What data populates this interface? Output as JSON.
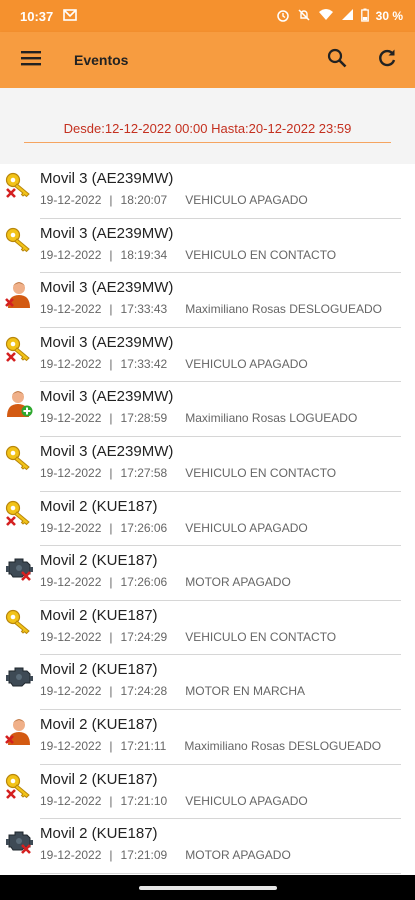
{
  "status_bar": {
    "time": "10:37",
    "battery": "30 %",
    "left_icons": [
      "mail-icon"
    ],
    "right_icons": [
      "alarm-icon",
      "mute-icon",
      "wifi-icon",
      "signal-icon",
      "battery-icon"
    ]
  },
  "app_bar": {
    "title": "Eventos",
    "icons": [
      "menu-icon",
      "search-icon",
      "refresh-icon"
    ],
    "color": "#f79c40"
  },
  "date_range": "Desde:12-12-2022 00:00  Hasta:20-12-2022 23:59",
  "events": [
    {
      "vehicle": "Movil 3 (AE239MW)",
      "date": "19-12-2022",
      "time": "18:20:07",
      "event": "VEHICULO APAGADO",
      "icon": "key-off-icon"
    },
    {
      "vehicle": "Movil 3 (AE239MW)",
      "date": "19-12-2022",
      "time": "18:19:34",
      "event": "VEHICULO EN CONTACTO",
      "icon": "key-icon"
    },
    {
      "vehicle": "Movil 3 (AE239MW)",
      "date": "19-12-2022",
      "time": "17:33:43",
      "event": "Maximiliano Rosas DESLOGUEADO",
      "icon": "user-logout-icon"
    },
    {
      "vehicle": "Movil 3 (AE239MW)",
      "date": "19-12-2022",
      "time": "17:33:42",
      "event": "VEHICULO APAGADO",
      "icon": "key-off-icon"
    },
    {
      "vehicle": "Movil 3 (AE239MW)",
      "date": "19-12-2022",
      "time": "17:28:59",
      "event": "Maximiliano Rosas LOGUEADO",
      "icon": "user-login-icon"
    },
    {
      "vehicle": "Movil 3 (AE239MW)",
      "date": "19-12-2022",
      "time": "17:27:58",
      "event": "VEHICULO EN CONTACTO",
      "icon": "key-icon"
    },
    {
      "vehicle": "Movil 2 (KUE187)",
      "date": "19-12-2022",
      "time": "17:26:06",
      "event": "VEHICULO APAGADO",
      "icon": "key-off-icon"
    },
    {
      "vehicle": "Movil 2 (KUE187)",
      "date": "19-12-2022",
      "time": "17:26:06",
      "event": "MOTOR APAGADO",
      "icon": "engine-off-icon"
    },
    {
      "vehicle": "Movil 2 (KUE187)",
      "date": "19-12-2022",
      "time": "17:24:29",
      "event": "VEHICULO EN CONTACTO",
      "icon": "key-icon"
    },
    {
      "vehicle": "Movil 2 (KUE187)",
      "date": "19-12-2022",
      "time": "17:24:28",
      "event": "MOTOR EN MARCHA",
      "icon": "engine-icon"
    },
    {
      "vehicle": "Movil 2 (KUE187)",
      "date": "19-12-2022",
      "time": "17:21:11",
      "event": "Maximiliano Rosas DESLOGUEADO",
      "icon": "user-logout-icon"
    },
    {
      "vehicle": "Movil 2 (KUE187)",
      "date": "19-12-2022",
      "time": "17:21:10",
      "event": "VEHICULO APAGADO",
      "icon": "key-off-icon"
    },
    {
      "vehicle": "Movil 2 (KUE187)",
      "date": "19-12-2022",
      "time": "17:21:09",
      "event": "MOTOR APAGADO",
      "icon": "engine-off-icon"
    }
  ]
}
